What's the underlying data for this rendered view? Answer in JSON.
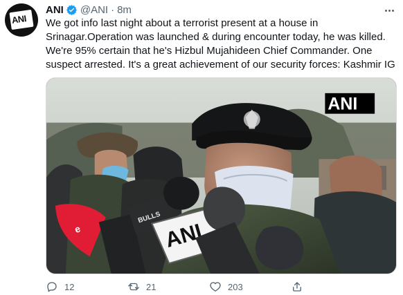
{
  "tweet": {
    "author": {
      "display_name": "ANI",
      "handle": "@ANI",
      "verified_icon": "verified-icon"
    },
    "timestamp": "8m",
    "text_lines": [
      "We got info last night about a terrorist present at a house in",
      "Srinagar.Operation was launched & during encounter today, he was killed.",
      "We're 95% certain that he's Hizbul Mujahideen Chief Commander. One",
      "suspect arrested. It's a great achievement of our security forces: Kashmir IG"
    ],
    "media": {
      "watermark": "ANI",
      "microphone_labels": [
        "ANI",
        "BULLS"
      ]
    },
    "actions": {
      "reply_count": "12",
      "retweet_count": "21",
      "like_count": "203"
    }
  },
  "icons": {
    "more": "more-horizontal-icon",
    "reply": "reply-icon",
    "retweet": "retweet-icon",
    "like": "heart-icon",
    "share": "share-icon"
  },
  "colors": {
    "verified_blue": "#1d9bf0",
    "text": "#0f1419",
    "secondary_text": "#536471"
  }
}
